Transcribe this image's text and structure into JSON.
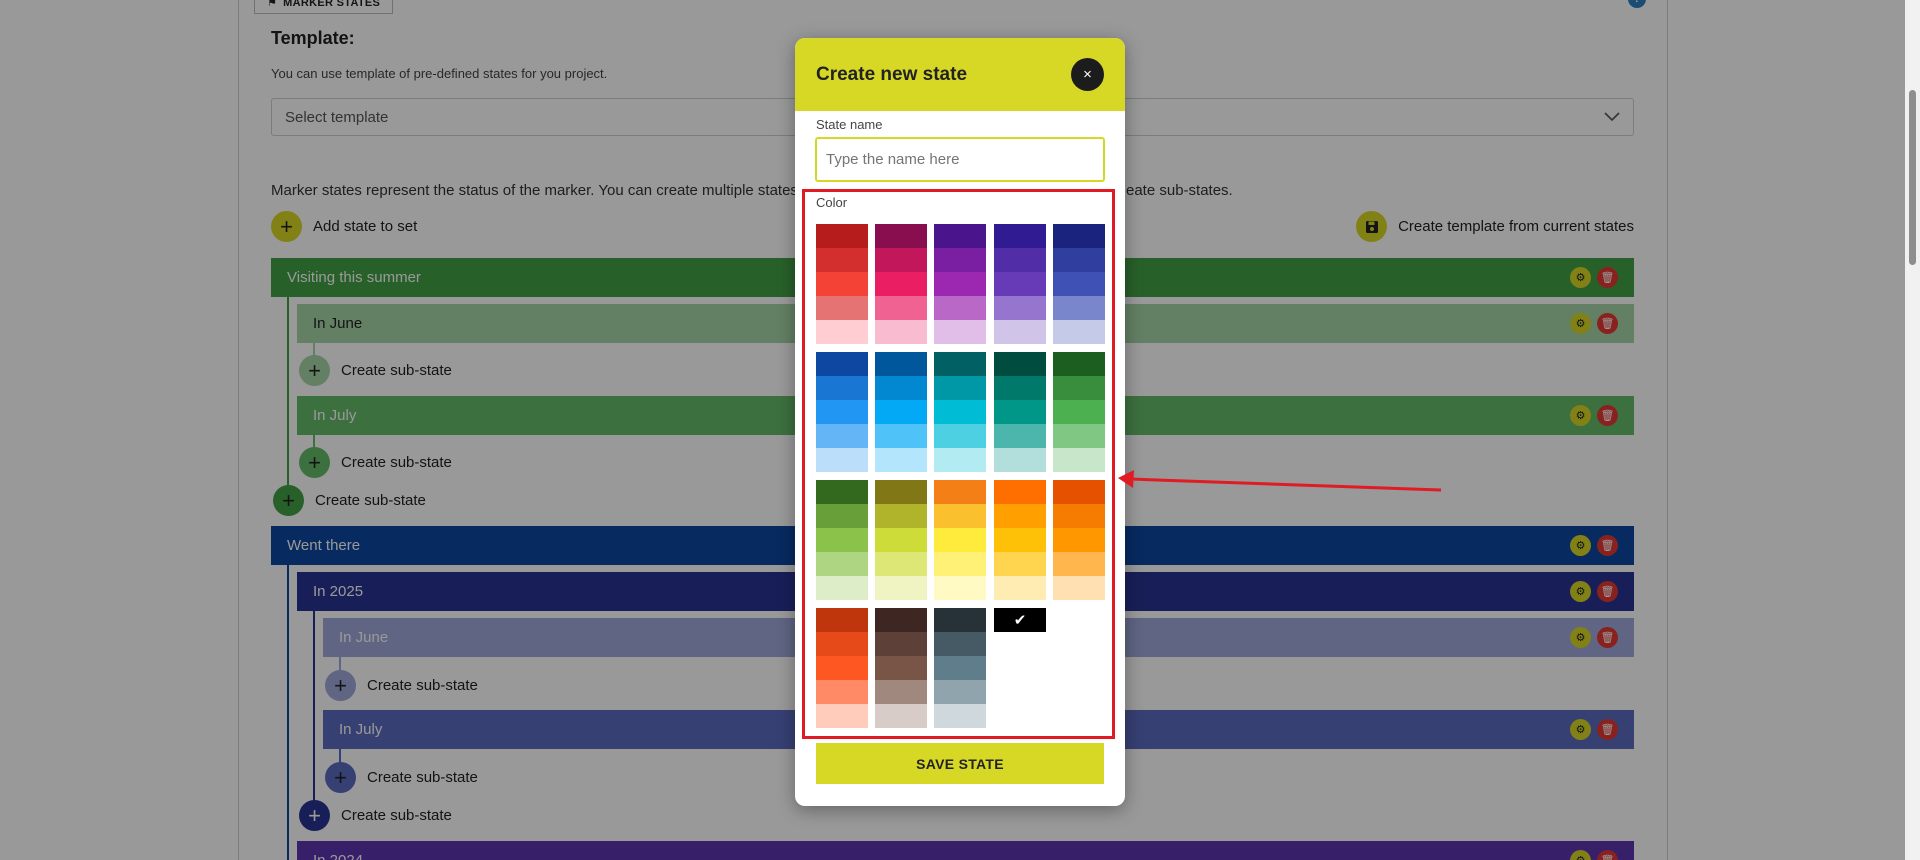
{
  "page": {
    "legend_label": "MARKER STATES",
    "help_icon": "?",
    "template_title": "Template:",
    "template_desc": "You can use template of pre-defined states for you project.",
    "template_placeholder": "Select template",
    "states_desc_head": "Marker states represent the status of the marker. You can create multiple states wit",
    "states_desc_tail": "eate sub-states.",
    "add_state_label": "Add state to set",
    "create_template_label": "Create template from current states",
    "create_sub_state": "Create sub-state",
    "states": [
      {
        "label": "Visiting this summer",
        "color": "#43a047"
      },
      {
        "label": "In June",
        "color": "#a5d6a7"
      },
      {
        "label": "In July",
        "color": "#66bb6a"
      },
      {
        "label": "Went there",
        "color": "#0d47a1"
      },
      {
        "label": "In 2025",
        "color": "#283593"
      },
      {
        "label": "In June",
        "color": "#9fa8da"
      },
      {
        "label": "In July",
        "color": "#5c6bc0"
      },
      {
        "label": "In 2024",
        "color": "#5e35b1"
      }
    ]
  },
  "modal": {
    "title": "Create new state",
    "close_icon": "×",
    "state_name_label": "State name",
    "state_name_placeholder": "Type the name here",
    "color_label": "Color",
    "selected_check": "✔",
    "save_label": "SAVE STATE",
    "palette": [
      [
        "#b71c1c",
        "#d32f2f",
        "#f44336",
        "#e57373",
        "#ffcdd2"
      ],
      [
        "#880e4f",
        "#c2185b",
        "#e91e63",
        "#f06292",
        "#f8bbd0"
      ],
      [
        "#4a148c",
        "#7b1fa2",
        "#9c27b0",
        "#ba68c8",
        "#e1bee7"
      ],
      [
        "#311b92",
        "#512da8",
        "#673ab7",
        "#9575cd",
        "#d1c4e9"
      ],
      [
        "#1a237e",
        "#303f9f",
        "#3f51b5",
        "#7986cb",
        "#c5cae9"
      ],
      [
        "#0d47a1",
        "#1976d2",
        "#2196f3",
        "#64b5f6",
        "#bbdefb"
      ],
      [
        "#01579b",
        "#0288d1",
        "#03a9f4",
        "#4fc3f7",
        "#b3e5fc"
      ],
      [
        "#006064",
        "#0097a7",
        "#00bcd4",
        "#4dd0e1",
        "#b2ebf2"
      ],
      [
        "#004d40",
        "#00796b",
        "#009688",
        "#4db6ac",
        "#b2dfdb"
      ],
      [
        "#1b5e20",
        "#388e3c",
        "#4caf50",
        "#81c784",
        "#c8e6c9"
      ],
      [
        "#33691e",
        "#689f38",
        "#8bc34a",
        "#aed581",
        "#dcedc8"
      ],
      [
        "#827717",
        "#afb42b",
        "#cddc39",
        "#dce775",
        "#f0f4c3"
      ],
      [
        "#f57f17",
        "#fbc02d",
        "#ffeb3b",
        "#fff176",
        "#fff9c4"
      ],
      [
        "#ff6f00",
        "#ffa000",
        "#ffc107",
        "#ffd54f",
        "#ffecb3"
      ],
      [
        "#e65100",
        "#f57c00",
        "#ff9800",
        "#ffb74d",
        "#ffe0b2"
      ],
      [
        "#bf360c",
        "#e64a19",
        "#ff5722",
        "#ff8a65",
        "#ffccbc"
      ],
      [
        "#3e2723",
        "#5d4037",
        "#795548",
        "#a1887f",
        "#d7ccc8"
      ],
      [
        "#263238",
        "#455a64",
        "#607d8b",
        "#90a4ae",
        "#cfd8dc"
      ]
    ]
  },
  "colors": {
    "accent": "#d7d826",
    "highlight": "#e01b24"
  }
}
